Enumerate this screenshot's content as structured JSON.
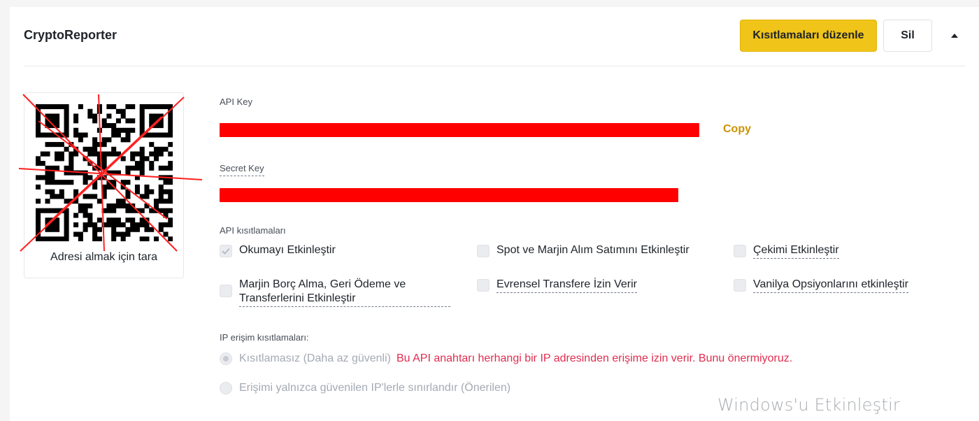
{
  "header": {
    "title": "CryptoReporter",
    "edit_label": "Kısıtlamaları düzenle",
    "delete_label": "Sil",
    "toggle_icon": "caret-up-icon"
  },
  "qr": {
    "caption": "Adresi almak için tara"
  },
  "api_key": {
    "label": "API Key",
    "copy_label": "Copy"
  },
  "secret_key": {
    "label": "Secret Key"
  },
  "restrictions": {
    "label": "API kısıtlamaları",
    "items": [
      {
        "label": "Okumayı Etkinleştir",
        "checked": true
      },
      {
        "label": "Spot ve Marjin Alım Satımını Etkinleştir",
        "checked": false
      },
      {
        "label": "Çekimi Etkinleştir",
        "checked": false
      },
      {
        "label_line1": "Marjin Borç Alma, Geri Ödeme ve",
        "label_line2": "Transferlerini Etkinleştir",
        "checked": false
      },
      {
        "label": "Evrensel Transfere İzin Verir",
        "checked": false
      },
      {
        "label": "Vanilya Opsiyonlarını etkinleştir",
        "checked": false
      }
    ]
  },
  "ip_access": {
    "label": "IP erişim kısıtlamaları:",
    "options": [
      {
        "label": "Kısıtlamasız (Daha az güvenli)",
        "selected": true
      },
      {
        "label": "Erişimi yalnızca güvenilen IP'lerle sınırlandır (Önerilen)",
        "selected": false
      }
    ],
    "warning": "Bu API anahtarı herhangi bir IP adresinden erişime izin verir. Bunu önermiyoruz."
  },
  "watermark": "Windows'u Etkinleştir",
  "colors": {
    "accent": "#f0c419",
    "link": "#c99400",
    "warning": "#e02d4f",
    "redaction": "#ff0000"
  }
}
